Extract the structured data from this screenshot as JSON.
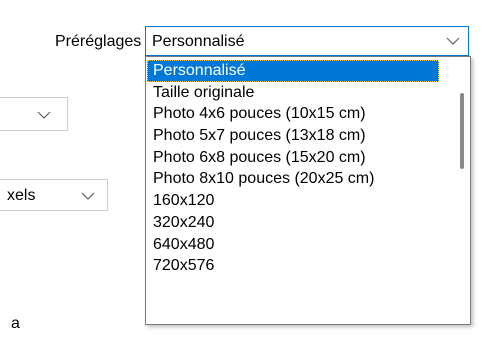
{
  "presets": {
    "label": "Préréglages",
    "selected_value": "Personnalisé",
    "options": [
      "Personnalisé",
      "Taille originale",
      "Photo 4x6 pouces (10x15 cm)",
      "Photo 5x7 pouces (13x18 cm)",
      "Photo 6x8 pouces (15x20 cm)",
      "Photo 8x10 pouces (20x25 cm)",
      "160x120",
      "320x240",
      "640x480",
      "720x576"
    ],
    "highlighted_index": 0
  },
  "background_controls": {
    "units_select_value_fragment": "xels",
    "label_fragment": "a"
  },
  "colors": {
    "accent": "#0078d7",
    "focus_border": "#0078d7"
  },
  "icons": {
    "dropdown_arrow": "chevron-down-icon"
  }
}
